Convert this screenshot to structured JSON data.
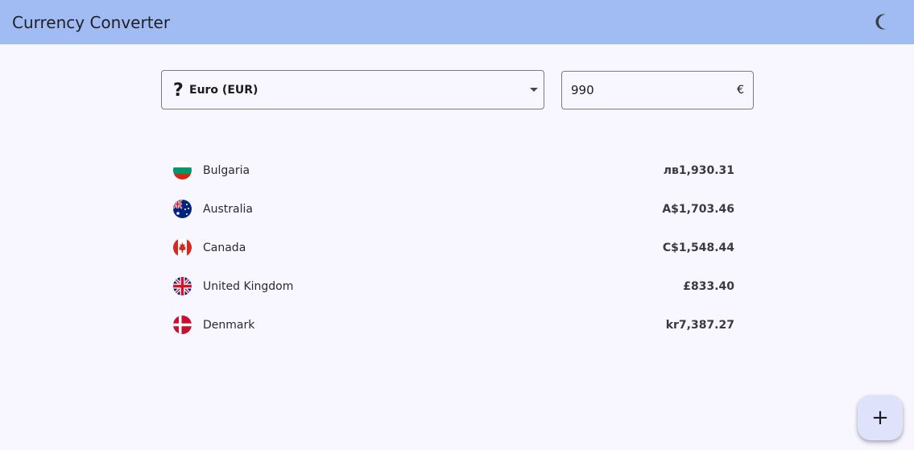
{
  "appbar": {
    "title": "Currency Converter",
    "theme_icon": "moon-icon",
    "color": "#a0bcf2"
  },
  "converter": {
    "base_currency": {
      "icon": "question-mark-icon",
      "icon_glyph": "?",
      "label": "Euro (EUR)"
    },
    "amount": {
      "value": "990",
      "suffix": "€"
    }
  },
  "rates": [
    {
      "country": "Bulgaria",
      "flag": "bulgaria-flag-icon",
      "amount": "лв1,930.31"
    },
    {
      "country": "Australia",
      "flag": "australia-flag-icon",
      "amount": "A$1,703.46"
    },
    {
      "country": "Canada",
      "flag": "canada-flag-icon",
      "amount": "C$1,548.44"
    },
    {
      "country": "United Kingdom",
      "flag": "uk-flag-icon",
      "amount": "£833.40"
    },
    {
      "country": "Denmark",
      "flag": "denmark-flag-icon",
      "amount": "kr7,387.27"
    }
  ],
  "fab": {
    "icon": "plus-icon",
    "glyph": "+"
  },
  "colors": {
    "background": "#f8f7ff",
    "fab_background": "#dfe2fb"
  }
}
